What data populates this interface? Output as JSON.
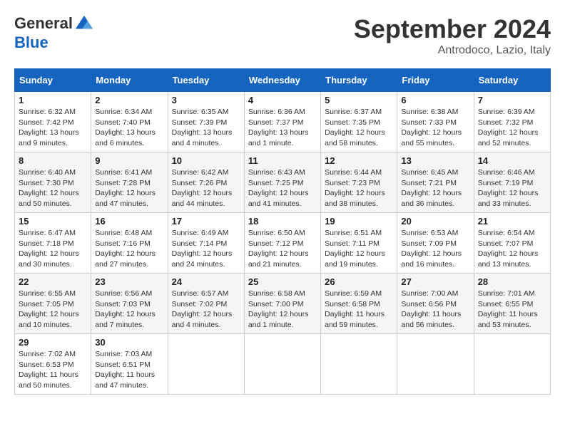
{
  "header": {
    "logo_general": "General",
    "logo_blue": "Blue",
    "month_title": "September 2024",
    "location": "Antrodoco, Lazio, Italy"
  },
  "days_of_week": [
    "Sunday",
    "Monday",
    "Tuesday",
    "Wednesday",
    "Thursday",
    "Friday",
    "Saturday"
  ],
  "weeks": [
    [
      {
        "day": 1,
        "sunrise": "6:32 AM",
        "sunset": "7:42 PM",
        "daylight": "13 hours and 9 minutes."
      },
      {
        "day": 2,
        "sunrise": "6:34 AM",
        "sunset": "7:40 PM",
        "daylight": "13 hours and 6 minutes."
      },
      {
        "day": 3,
        "sunrise": "6:35 AM",
        "sunset": "7:39 PM",
        "daylight": "13 hours and 4 minutes."
      },
      {
        "day": 4,
        "sunrise": "6:36 AM",
        "sunset": "7:37 PM",
        "daylight": "13 hours and 1 minute."
      },
      {
        "day": 5,
        "sunrise": "6:37 AM",
        "sunset": "7:35 PM",
        "daylight": "12 hours and 58 minutes."
      },
      {
        "day": 6,
        "sunrise": "6:38 AM",
        "sunset": "7:33 PM",
        "daylight": "12 hours and 55 minutes."
      },
      {
        "day": 7,
        "sunrise": "6:39 AM",
        "sunset": "7:32 PM",
        "daylight": "12 hours and 52 minutes."
      }
    ],
    [
      {
        "day": 8,
        "sunrise": "6:40 AM",
        "sunset": "7:30 PM",
        "daylight": "12 hours and 50 minutes."
      },
      {
        "day": 9,
        "sunrise": "6:41 AM",
        "sunset": "7:28 PM",
        "daylight": "12 hours and 47 minutes."
      },
      {
        "day": 10,
        "sunrise": "6:42 AM",
        "sunset": "7:26 PM",
        "daylight": "12 hours and 44 minutes."
      },
      {
        "day": 11,
        "sunrise": "6:43 AM",
        "sunset": "7:25 PM",
        "daylight": "12 hours and 41 minutes."
      },
      {
        "day": 12,
        "sunrise": "6:44 AM",
        "sunset": "7:23 PM",
        "daylight": "12 hours and 38 minutes."
      },
      {
        "day": 13,
        "sunrise": "6:45 AM",
        "sunset": "7:21 PM",
        "daylight": "12 hours and 36 minutes."
      },
      {
        "day": 14,
        "sunrise": "6:46 AM",
        "sunset": "7:19 PM",
        "daylight": "12 hours and 33 minutes."
      }
    ],
    [
      {
        "day": 15,
        "sunrise": "6:47 AM",
        "sunset": "7:18 PM",
        "daylight": "12 hours and 30 minutes."
      },
      {
        "day": 16,
        "sunrise": "6:48 AM",
        "sunset": "7:16 PM",
        "daylight": "12 hours and 27 minutes."
      },
      {
        "day": 17,
        "sunrise": "6:49 AM",
        "sunset": "7:14 PM",
        "daylight": "12 hours and 24 minutes."
      },
      {
        "day": 18,
        "sunrise": "6:50 AM",
        "sunset": "7:12 PM",
        "daylight": "12 hours and 21 minutes."
      },
      {
        "day": 19,
        "sunrise": "6:51 AM",
        "sunset": "7:11 PM",
        "daylight": "12 hours and 19 minutes."
      },
      {
        "day": 20,
        "sunrise": "6:53 AM",
        "sunset": "7:09 PM",
        "daylight": "12 hours and 16 minutes."
      },
      {
        "day": 21,
        "sunrise": "6:54 AM",
        "sunset": "7:07 PM",
        "daylight": "12 hours and 13 minutes."
      }
    ],
    [
      {
        "day": 22,
        "sunrise": "6:55 AM",
        "sunset": "7:05 PM",
        "daylight": "12 hours and 10 minutes."
      },
      {
        "day": 23,
        "sunrise": "6:56 AM",
        "sunset": "7:03 PM",
        "daylight": "12 hours and 7 minutes."
      },
      {
        "day": 24,
        "sunrise": "6:57 AM",
        "sunset": "7:02 PM",
        "daylight": "12 hours and 4 minutes."
      },
      {
        "day": 25,
        "sunrise": "6:58 AM",
        "sunset": "7:00 PM",
        "daylight": "12 hours and 1 minute."
      },
      {
        "day": 26,
        "sunrise": "6:59 AM",
        "sunset": "6:58 PM",
        "daylight": "11 hours and 59 minutes."
      },
      {
        "day": 27,
        "sunrise": "7:00 AM",
        "sunset": "6:56 PM",
        "daylight": "11 hours and 56 minutes."
      },
      {
        "day": 28,
        "sunrise": "7:01 AM",
        "sunset": "6:55 PM",
        "daylight": "11 hours and 53 minutes."
      }
    ],
    [
      {
        "day": 29,
        "sunrise": "7:02 AM",
        "sunset": "6:53 PM",
        "daylight": "11 hours and 50 minutes."
      },
      {
        "day": 30,
        "sunrise": "7:03 AM",
        "sunset": "6:51 PM",
        "daylight": "11 hours and 47 minutes."
      },
      null,
      null,
      null,
      null,
      null
    ]
  ]
}
